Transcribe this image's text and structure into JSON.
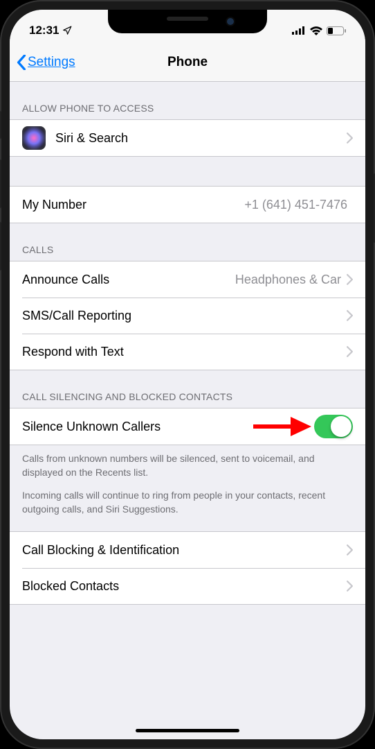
{
  "status": {
    "time": "12:31",
    "location_glyph": "➤"
  },
  "nav": {
    "back_label": "Settings",
    "title": "Phone"
  },
  "sections": {
    "access": {
      "header": "ALLOW PHONE TO ACCESS",
      "siri_label": "Siri & Search"
    },
    "number": {
      "label": "My Number",
      "value": "+1 (641) 451-7476"
    },
    "calls": {
      "header": "CALLS",
      "announce": {
        "label": "Announce Calls",
        "value": "Headphones & Car"
      },
      "sms": {
        "label": "SMS/Call Reporting"
      },
      "respond": {
        "label": "Respond with Text"
      }
    },
    "silencing": {
      "header": "CALL SILENCING AND BLOCKED CONTACTS",
      "silence": {
        "label": "Silence Unknown Callers",
        "toggle_on": true
      },
      "footer1": "Calls from unknown numbers will be silenced, sent to voicemail, and displayed on the Recents list.",
      "footer2": "Incoming calls will continue to ring from people in your contacts, recent outgoing calls, and Siri Suggestions.",
      "blocking": {
        "label": "Call Blocking & Identification"
      },
      "blocked": {
        "label": "Blocked Contacts"
      }
    }
  },
  "annotation": {
    "arrow_color": "#ff0000"
  }
}
